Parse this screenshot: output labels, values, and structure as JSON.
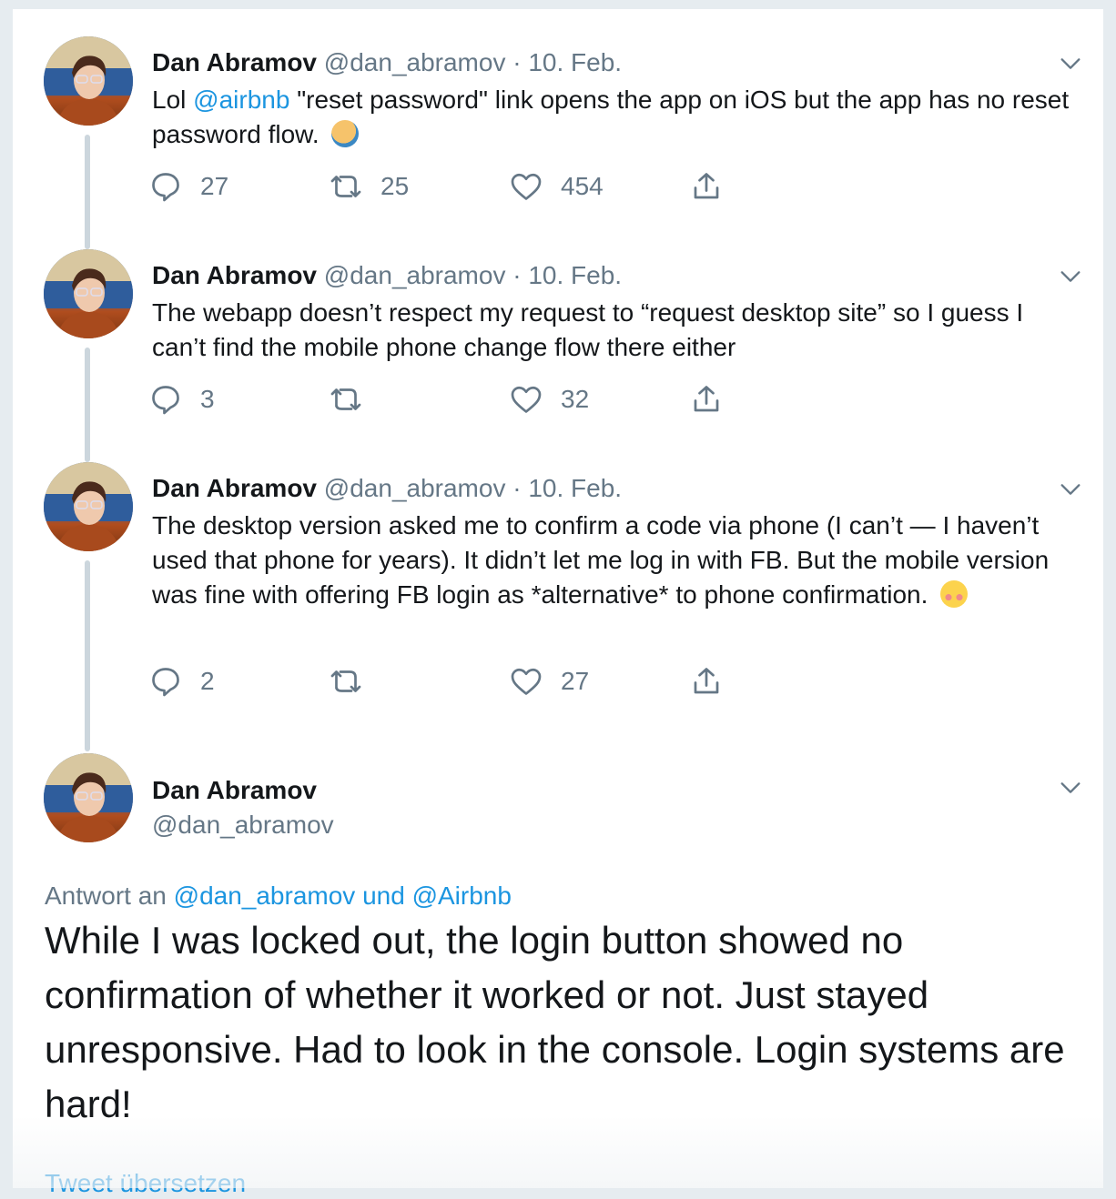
{
  "tweets": [
    {
      "name": "Dan Abramov",
      "handle": "@dan_abramov",
      "dot": "·",
      "date": "10. Feb.",
      "text_prefix": "Lol ",
      "mention": "@airbnb",
      "text_suffix": " \"reset password\" link opens the app on iOS but the app has no reset password flow.",
      "emoji": "facepalm",
      "replies": "27",
      "retweets": "25",
      "likes": "454"
    },
    {
      "name": "Dan Abramov",
      "handle": "@dan_abramov",
      "dot": "·",
      "date": "10. Feb.",
      "text": "The webapp doesn’t respect my request to “request desktop site” so I guess I can’t find the mobile phone change flow there either",
      "replies": "3",
      "retweets": "",
      "likes": "32"
    },
    {
      "name": "Dan Abramov",
      "handle": "@dan_abramov",
      "dot": "·",
      "date": "10. Feb.",
      "text": "The desktop version asked me to confirm a code via phone (I can’t — I haven’t used that phone for years). It didn’t let me log in with FB. But the mobile version was fine with offering FB login as *alternative* to phone confirmation.",
      "emoji": "flushed",
      "replies": "2",
      "retweets": "",
      "likes": "27"
    }
  ],
  "main": {
    "name": "Dan Abramov",
    "handle": "@dan_abramov",
    "reply_prefix": "Antwort an ",
    "reply_mentions": "@dan_abramov und @Airbnb",
    "text": "While I was locked out, the login button showed no confirmation of whether it worked or not. Just stayed unresponsive. Had to look in the console. Login systems are hard!",
    "translate": "Tweet übersetzen"
  },
  "colors": {
    "accent": "#1b95e0",
    "muted": "#657786",
    "thread_line": "#ccd6dd"
  },
  "icons": [
    "reply-icon",
    "retweet-icon",
    "like-icon",
    "share-icon",
    "chevron-down-icon"
  ]
}
